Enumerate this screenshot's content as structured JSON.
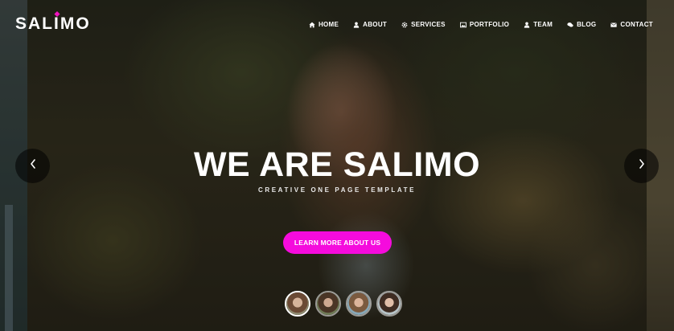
{
  "brand": {
    "logo_part1": "SAL",
    "logo_i": "I",
    "logo_part2": "MO",
    "accent_color": "#f012be"
  },
  "nav": {
    "items": [
      {
        "label": "HOME",
        "icon": "home-icon"
      },
      {
        "label": "ABOUT",
        "icon": "user-icon"
      },
      {
        "label": "SERVICES",
        "icon": "gear-icon"
      },
      {
        "label": "PORTFOLIO",
        "icon": "image-icon"
      },
      {
        "label": "TEAM",
        "icon": "user-icon"
      },
      {
        "label": "BLOG",
        "icon": "comments-icon"
      },
      {
        "label": "CONTACT",
        "icon": "envelope-icon"
      }
    ]
  },
  "hero": {
    "title": "WE ARE SALIMO",
    "subtitle": "CREATIVE ONE PAGE TEMPLATE",
    "cta_label": "LEARN MORE ABOUT US",
    "cta_color": "#f50bdd"
  },
  "slider": {
    "prev_icon": "chevron-left-icon",
    "next_icon": "chevron-right-icon",
    "thumbnails_count": 4,
    "active_index": 0
  }
}
